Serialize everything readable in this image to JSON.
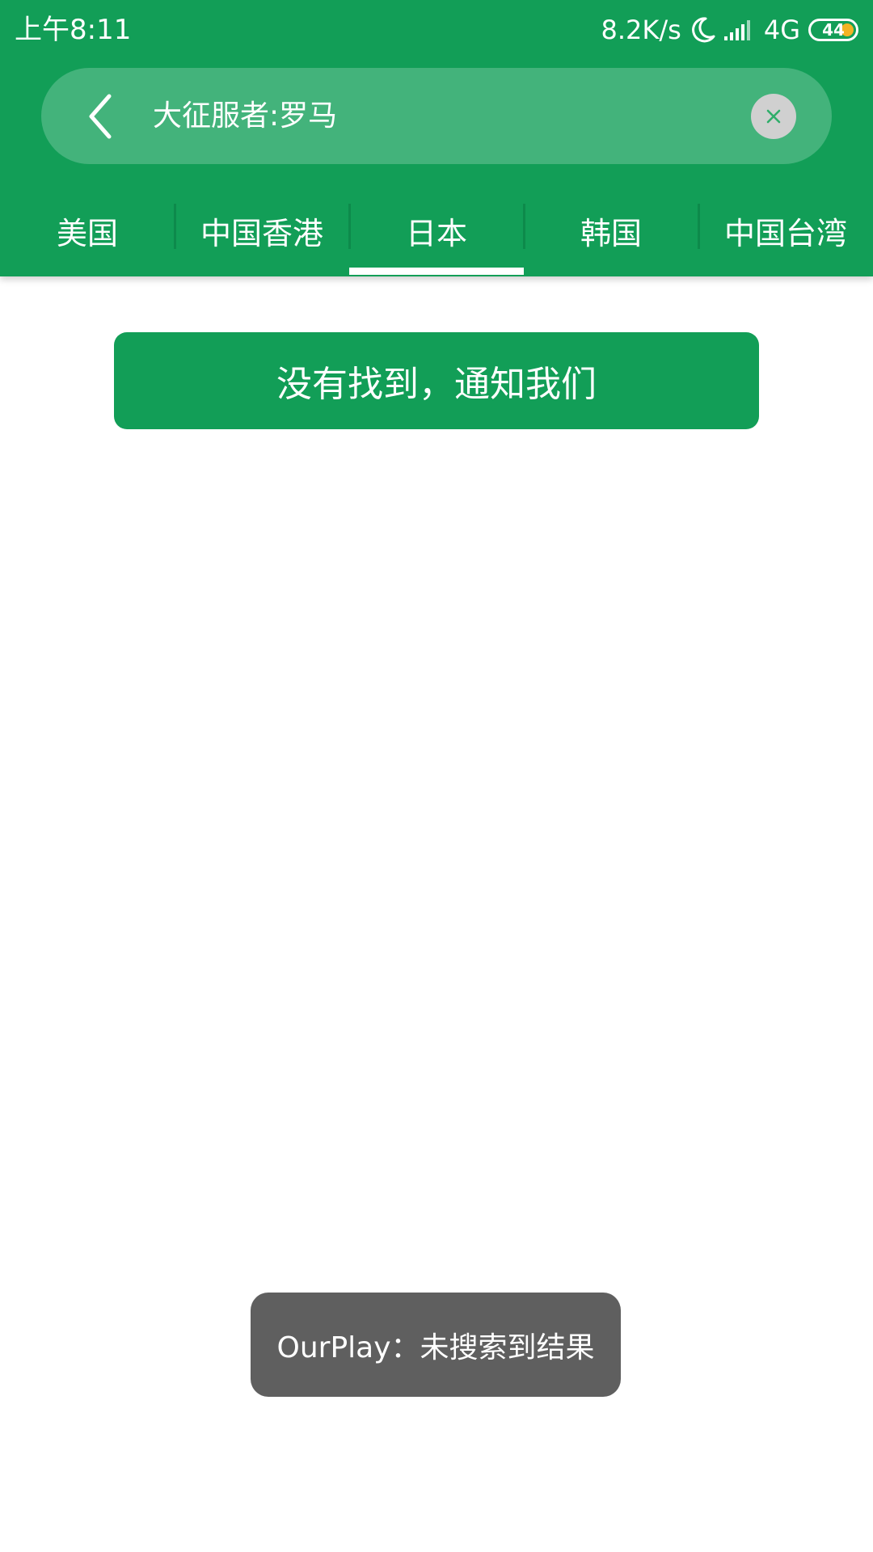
{
  "status_bar": {
    "time": "上午8:11",
    "network_speed": "8.2K/s",
    "network_type": "4G",
    "battery_level": "44",
    "icons": [
      "moon-icon",
      "signal-icon",
      "battery-icon"
    ]
  },
  "search": {
    "query": "大征服者:罗马",
    "back_icon": "back-arrow-icon",
    "clear_icon": "close-icon"
  },
  "tabs": [
    {
      "label": "美国",
      "selected": false
    },
    {
      "label": "中国香港",
      "selected": false
    },
    {
      "label": "日本",
      "selected": true
    },
    {
      "label": "韩国",
      "selected": false
    },
    {
      "label": "中国台湾",
      "selected": false
    }
  ],
  "main": {
    "notify_button_label": "没有找到，通知我们"
  },
  "toast": {
    "message": "OurPlay：未搜索到结果"
  },
  "colors": {
    "primary": "#129e57",
    "search_bg": "#43b37b",
    "toast_bg": "#5f5f5f",
    "battery_accent": "#f2b324"
  }
}
